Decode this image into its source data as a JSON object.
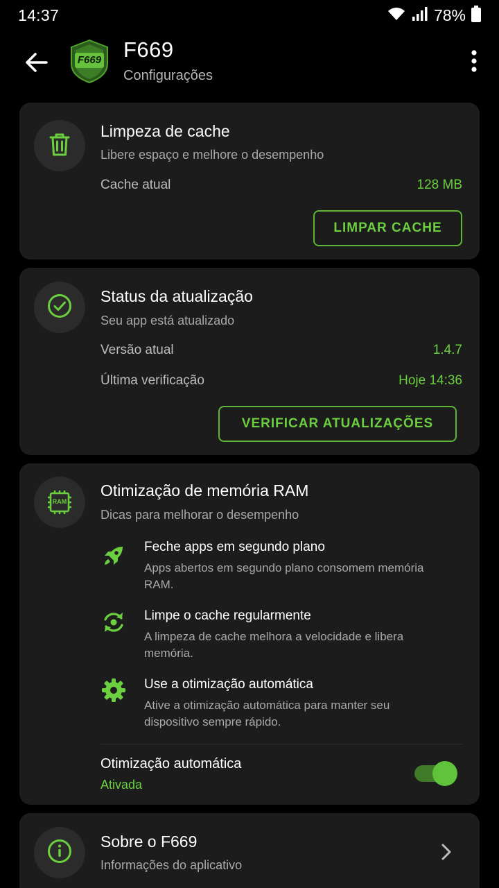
{
  "status_bar": {
    "time": "14:37",
    "battery_percent": "78%",
    "icons": [
      "wifi-icon",
      "signal-icon",
      "battery-icon"
    ]
  },
  "app_bar": {
    "title": "F669",
    "subtitle": "Configurações",
    "logo_text": "F669",
    "back_icon": "arrow-left-icon",
    "menu_icon": "more-vert-icon"
  },
  "colors": {
    "accent": "#6ccf3f",
    "card_bg": "#1c1c1c",
    "background": "#000000"
  },
  "cache_card": {
    "icon": "trash-icon",
    "title": "Limpeza de cache",
    "subtitle": "Libere espaço e melhore o desempenho",
    "row_label": "Cache atual",
    "row_value": "128 MB",
    "button_label": "LIMPAR CACHE"
  },
  "update_card": {
    "icon": "check-circle-icon",
    "title": "Status da atualização",
    "subtitle": "Seu app está atualizado",
    "rows": [
      {
        "label": "Versão atual",
        "value": "1.4.7"
      },
      {
        "label": "Última verificação",
        "value": "Hoje 14:36"
      }
    ],
    "button_label": "VERIFICAR ATUALIZAÇÕES"
  },
  "ram_card": {
    "icon": "ram-chip-icon",
    "icon_text": "RAM",
    "title": "Otimização de memória RAM",
    "subtitle": "Dicas para melhorar o desempenho",
    "tips": [
      {
        "icon": "rocket-icon",
        "title": "Feche apps em segundo plano",
        "desc": "Apps abertos em segundo plano consomem memória RAM."
      },
      {
        "icon": "refresh-icon",
        "title": "Limpe o cache regularmente",
        "desc": "A limpeza de cache melhora a velocidade e libera memória."
      },
      {
        "icon": "gear-icon",
        "title": "Use a otimização automática",
        "desc": "Ative a otimização automática para manter seu dispositivo sempre rápido."
      }
    ],
    "toggle_label": "Otimização automática",
    "toggle_status": "Ativada",
    "toggle_on": true
  },
  "about_card": {
    "icon": "info-icon",
    "title": "Sobre o F669",
    "subtitle": "Informações do aplicativo",
    "chevron_icon": "chevron-right-icon"
  }
}
